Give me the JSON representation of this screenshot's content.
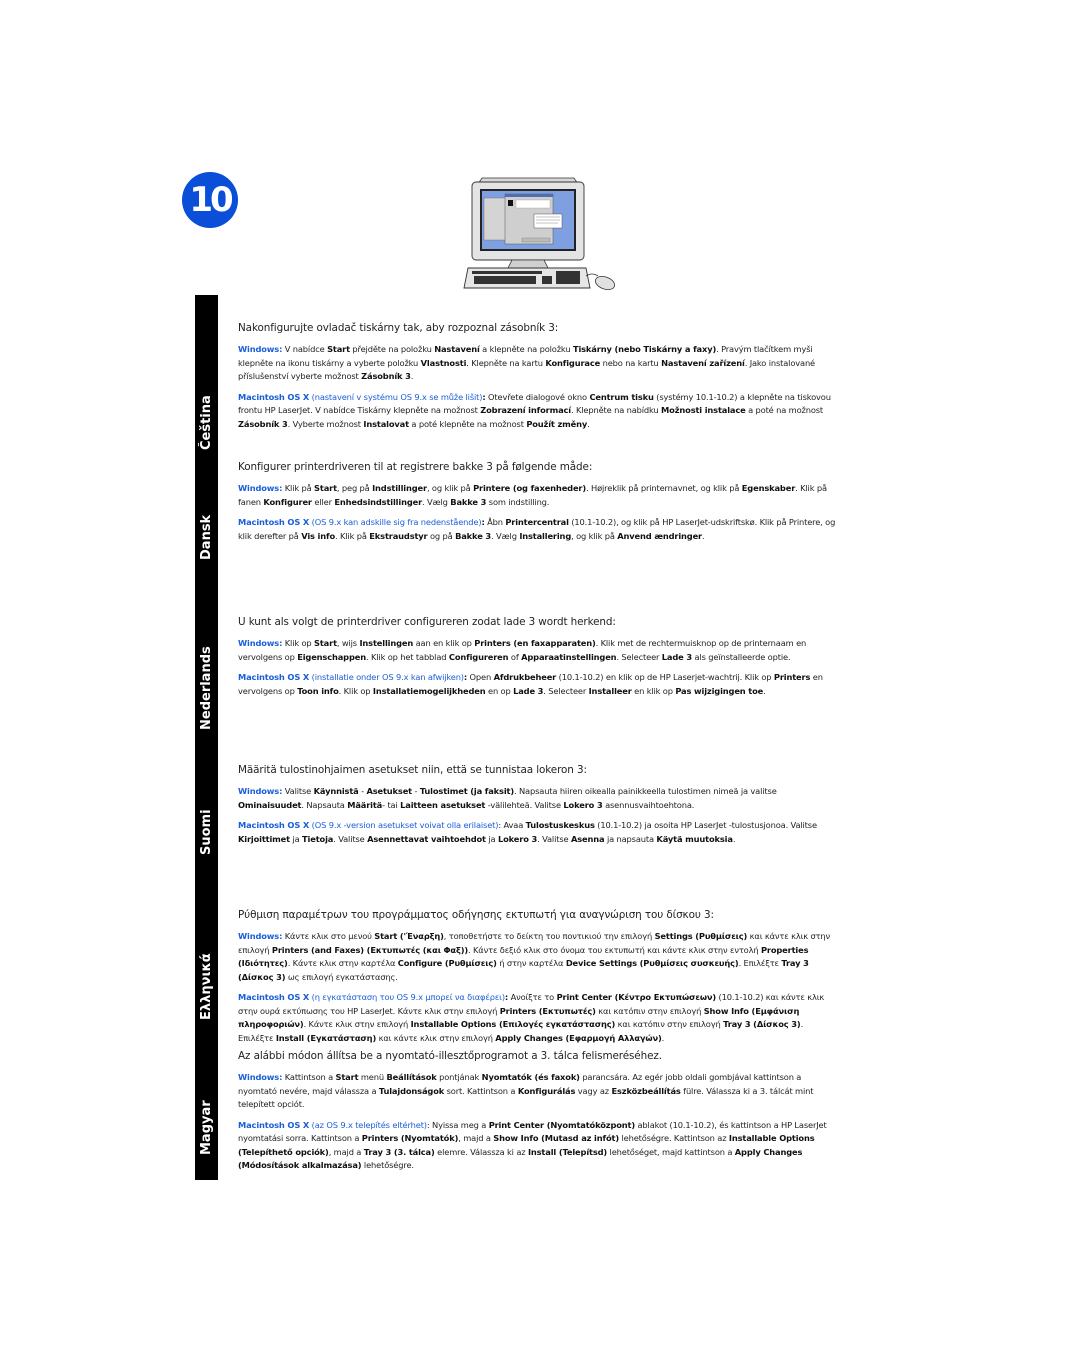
{
  "step": {
    "number": "10"
  },
  "illustration": {
    "icon": "computer-monitor-keyboard-mouse-icon"
  },
  "colors": {
    "accent_blue": "#0b4fd8",
    "link_blue": "#1a5fd8",
    "lang_bar": "#000000"
  },
  "sections": [
    {
      "lang": "Čeština",
      "intro": "Nakonfigurujte ovladač tiskárny tak, aby rozpoznal zásobník 3:",
      "windows_label": "Windows:",
      "windows_html": " V nabídce <b>Start</b> přejděte na položku <b>Nastavení</b> a klepněte na položku <b>Tiskárny (nebo Tiskárny a faxy)</b>. Pravým tlačítkem myši klepněte na ikonu tiskárny a vyberte položku <b>Vlastnosti</b>. Klepněte na kartu <b>Konfigurace</b> nebo na kartu <b>Nastavení zařízení</b>. Jako instalované příslušenství vyberte možnost <b>Zásobník 3</b>.",
      "mac_label": "Macintosh OS X",
      "mac_note": " (nastavení v systému OS 9.x se může lišit)",
      "mac_html": "<b>:</b> Otevřete dialogové okno <b>Centrum tisku</b> (systémy 10.1-10.2) a klepněte na tiskovou frontu HP LaserJet. V nabídce Tiskárny klepněte na možnost <b>Zobrazení informací</b>. Klepněte na nabídku <b>Možnosti instalace</b> a poté na možnost <b>Zásobník 3</b>. Vyberte možnost <b>Instalovat</b> a poté klepněte na možnost <b>Použít změny</b>."
    },
    {
      "lang": "Dansk",
      "intro": "Konfigurer printerdriveren til at registrere bakke 3 på følgende måde:",
      "windows_label": "Windows:",
      "windows_html": " Klik på <b>Start</b>, peg på <b>Indstillinger</b>, og klik på <b>Printere (og faxenheder)</b>. Højreklik på printernavnet, og klik på <b>Egenskaber</b>. Klik på fanen <b>Konfigurer</b> eller <b>Enhedsindstillinger</b>. Vælg <b>Bakke 3</b> som indstilling.",
      "mac_label": "Macintosh OS X",
      "mac_note": " (OS 9.x kan adskille sig fra nedenstående)",
      "mac_html": "<b>:</b> Åbn <b>Printercentral</b> (10.1-10.2), og klik på HP LaserJet-udskriftskø. Klik på Printere, og klik derefter på <b>Vis info</b>. Klik på <b>Ekstraudstyr</b> og på <b>Bakke 3</b>. Vælg <b>Installering</b>, og klik på <b>Anvend ændringer</b>."
    },
    {
      "lang": "Nederlands",
      "intro": "U kunt als volgt de printerdriver configureren zodat lade 3 wordt herkend:",
      "windows_label": "Windows:",
      "windows_html": " Klik op <b>Start</b>, wijs <b>Instellingen</b> aan en klik op <b>Printers (en faxapparaten)</b>. Klik met de rechtermuisknop op de printernaam en vervolgens op <b>Eigenschappen</b>. Klik op het tabblad <b>Configureren</b> of <b>Apparaatinstellingen</b>. Selecteer <b>Lade 3</b> als geïnstalleerde optie.",
      "mac_label": "Macintosh OS X",
      "mac_note": " (installatie onder OS 9.x kan afwijken)",
      "mac_html": "<b>:</b> Open <b>Afdrukbeheer</b> (10.1-10.2) en klik op de HP Laserjet-wachtrij. Klik op <b>Printers</b> en vervolgens op <b>Toon info</b>. Klik op <b>Installatiemogelijkheden</b> en op <b>Lade 3</b>. Selecteer <b>Installeer</b> en klik op <b>Pas wijzigingen toe</b>."
    },
    {
      "lang": "Suomi",
      "intro": "Määritä tulostinohjaimen asetukset niin, että se tunnistaa lokeron 3:",
      "windows_label": "Windows:",
      "windows_html": " Valitse <b>Käynnistä</b> - <b>Asetukset</b> - <b>Tulostimet (ja faksit)</b>. Napsauta hiiren oikealla painikkeella tulostimen nimeä ja valitse <b>Ominaisuudet</b>. Napsauta <b>Määritä</b>- tai <b>Laitteen asetukset</b> -välilehteä. Valitse <b>Lokero 3</b> asennusvaihtoehtona.",
      "mac_label": "Macintosh OS X",
      "mac_note": " (OS 9.x -version asetukset voivat olla erilaiset)",
      "mac_html": ": Avaa <b>Tulostuskeskus</b> (10.1-10.2) ja osoita HP LaserJet -tulostusjonoa. Valitse <b>Kirjoittimet</b> ja <b>Tietoja</b>. Valitse <b>Asennettavat vaihtoehdot</b> ja <b>Lokero 3</b>. Valitse <b>Asenna</b> ja napsauta <b>Käytä muutoksia</b>."
    },
    {
      "lang": "Ελληνικά",
      "intro": "Ρύθμιση παραμέτρων του προγράμματος οδήγησης εκτυπωτή για αναγνώριση του δίσκου 3:",
      "windows_label": "Windows:",
      "windows_html": " Κάντε κλικ στο μενού <b>Start ('Έναρξη)</b>, τοποθετήστε το δείκτη του ποντικιού την επιλογή <b>Settings (Ρυθμίσεις)</b> και κάντε κλικ στην επιλογή <b>Printers (and Faxes) (Εκτυπωτές (και Φαξ))</b>. Κάντε δεξιό κλικ στο όνομα του εκτυπωτή και κάντε κλικ στην εντολή <b>Properties (Ιδιότητες)</b>. Κάντε κλικ στην καρτέλα <b>Configure (Ρυθμίσεις)</b> ή στην καρτέλα <b>Device Settings (Ρυθμίσεις συσκευής)</b>. Επιλέξτε <b>Tray 3 (Δίσκος 3)</b> ως επιλογή εγκατάστασης.",
      "mac_label": "Macintosh OS X",
      "mac_note": " (η εγκατάσταση του OS 9.x μπορεί να διαφέρει)",
      "mac_html": "<b>:</b> Ανοίξτε το <b>Print Center (Κέντρο Εκτυπώσεων)</b> (10.1-10.2) και κάντε κλικ στην ουρά εκτύπωσης του HP LaserJet. Κάντε κλικ στην επιλογή <b>Printers (Εκτυπωτές)</b> και κατόπιν στην επιλογή <b>Show Info (Εμφάνιση πληροφοριών)</b>. Κάντε κλικ στην επιλογή <b>Installable Options (Επιλογές εγκατάστασης)</b> και κατόπιν στην επιλογή <b>Tray 3 (Δίσκος 3)</b>. Επιλέξτε <b>Install (Εγκατάσταση)</b> και κάντε κλικ στην επιλογή <b>Apply Changes (Εφαρμογή Αλλαγών)</b>."
    },
    {
      "lang": "Magyar",
      "intro": "Az alábbi módon állítsa be a nyomtató-illesztőprogramot a 3. tálca felismeréséhez.",
      "windows_label": "Windows:",
      "windows_html": " Kattintson a <b>Start</b> menü <b>Beállítások</b> pontjának <b>Nyomtatók (és faxok)</b> parancsára. Az egér jobb oldali gombjával kattintson a nyomtató nevére, majd válassza a <b>Tulajdonságok</b> sort. Kattintson a <b>Konfigurálás</b> vagy az <b>Eszközbeállítás</b> fülre. Válassza ki a 3. tálcát mint telepített opciót.",
      "mac_label": "Macintosh OS X",
      "mac_note": " (az OS 9.x telepítés eltérhet)",
      "mac_html": ": Nyissa meg a <b>Print Center (Nyomtatóközpont)</b> ablakot (10.1-10.2), és kattintson a HP LaserJet nyomtatási sorra. Kattintson a <b>Printers (Nyomtatók)</b>, majd a <b>Show Info (Mutasd az infót)</b> lehetőségre. Kattintson az <b>Installable Options (Telepíthető opciók)</b>, majd a <b>Tray 3 (3. tálca)</b> elemre. Válassza ki az <b>Install (Telepítsd)</b> lehetőséget, majd kattintson a <b>Apply Changes (Módosítások alkalmazása)</b> lehetőségre."
    }
  ]
}
